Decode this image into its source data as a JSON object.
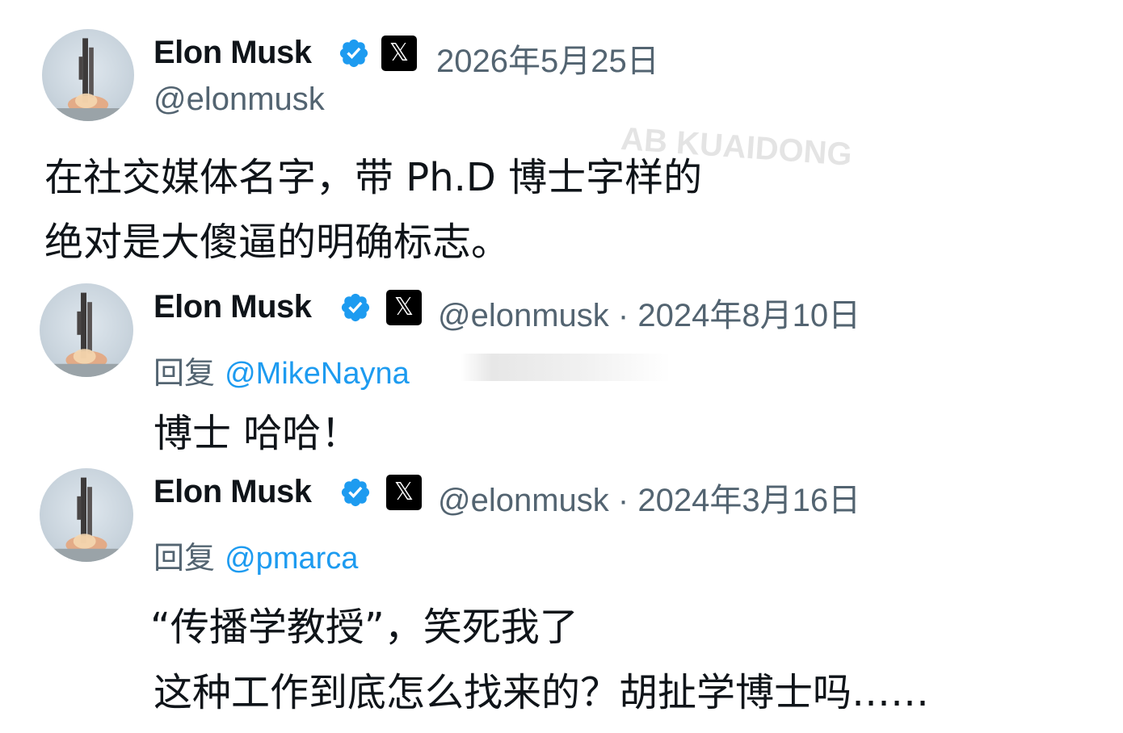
{
  "tweets": [
    {
      "author_name": "Elon Musk",
      "handle": "@elonmusk",
      "date": "2026年5月25日",
      "text_lines": [
        "在社交媒体名字，带 Ph.D 博士字样的",
        "绝对是大傻逼的明确标志。"
      ]
    },
    {
      "author_name": "Elon Musk",
      "handle_date": "@elonmusk · 2024年8月10日",
      "reply_prefix": "回复",
      "reply_to": "@MikeNayna",
      "text_lines": [
        "博士 哈哈！"
      ]
    },
    {
      "author_name": "Elon Musk",
      "handle_date": "@elonmusk · 2024年3月16日",
      "reply_prefix": "回复",
      "reply_to": "@pmarca",
      "text_lines": [
        "“传播学教授”，笑死我了",
        "这种工作到底怎么找来的？胡扯学博士吗……"
      ]
    }
  ],
  "watermark": "AB KUAIDONG",
  "icons": {
    "verified": "verified-badge-icon",
    "x_logo": "x-logo-icon",
    "avatar": "rocket-launch-avatar"
  },
  "colors": {
    "text": "#0f1419",
    "secondary": "#536471",
    "link": "#1d9bf0",
    "verified": "#1d9bf0"
  }
}
